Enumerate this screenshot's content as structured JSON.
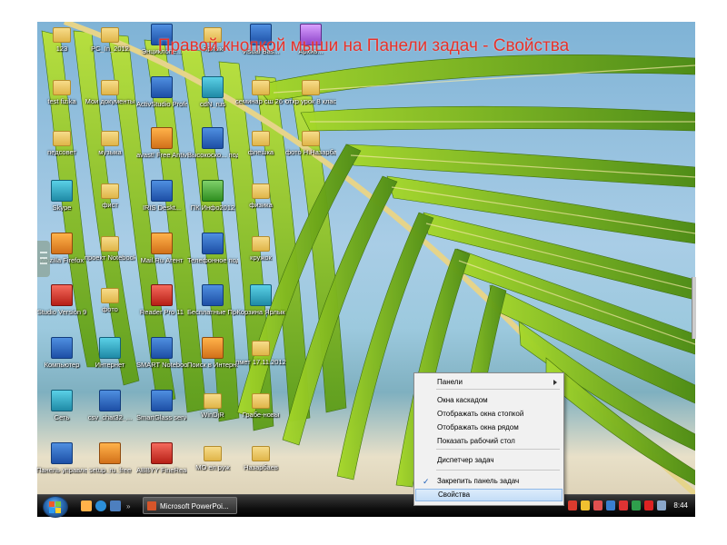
{
  "slide_title": "Правой кнопкой мыши на Панели задач - Свойства",
  "desktop_icons": [
    {
      "label": "123",
      "kind": "folder"
    },
    {
      "label": "PC_In_2012",
      "kind": "folder"
    },
    {
      "label": "Энциклопе...",
      "kind": "app",
      "color": "app"
    },
    {
      "label": "Ярлык",
      "kind": "folder"
    },
    {
      "label": "Visual Bas...",
      "kind": "app",
      "color": "app"
    },
    {
      "label": "Архив...",
      "kind": "app",
      "color": "purple"
    },
    {
      "label": "test fizika",
      "kind": "folder"
    },
    {
      "label": "Мои документы",
      "kind": "folder"
    },
    {
      "label": "ActivStudio Professio...",
      "kind": "app",
      "color": "app"
    },
    {
      "label": "cdN_rus",
      "kind": "app",
      "color": "teal"
    },
    {
      "label": "семинар сш 26 О ИВТ 20...",
      "kind": "folder"
    },
    {
      "label": "откр урок 8 класс 201...",
      "kind": "folder"
    },
    {
      "label": "педсовет",
      "kind": "folder"
    },
    {
      "label": "музыка",
      "kind": "folder"
    },
    {
      "label": "avast! Free Antivirus",
      "kind": "app",
      "color": "orange"
    },
    {
      "label": "Высокоско... подключе...",
      "kind": "app",
      "color": "app"
    },
    {
      "label": "флешка",
      "kind": "folder"
    },
    {
      "label": "фото Н.Назарба...",
      "kind": "folder"
    },
    {
      "label": "Skype",
      "kind": "app",
      "color": "teal"
    },
    {
      "label": "фист",
      "kind": "folder"
    },
    {
      "label": "IRIS Deskt...",
      "kind": "app",
      "color": "app"
    },
    {
      "label": "ПК Инфо2012",
      "kind": "app",
      "color": "green"
    },
    {
      "label": "физика",
      "kind": "folder"
    },
    {
      "label": "Mozilla Firefox",
      "kind": "app",
      "color": "orange"
    },
    {
      "label": "проект Notebook",
      "kind": "folder"
    },
    {
      "label": "Mail.Ru Агент",
      "kind": "app",
      "color": "orange"
    },
    {
      "label": "Телефонное подключе...",
      "kind": "app",
      "color": "app"
    },
    {
      "label": "кружок",
      "kind": "folder"
    },
    {
      "label": "Studio Version 9",
      "kind": "app",
      "color": "red"
    },
    {
      "label": "фото",
      "kind": "folder"
    },
    {
      "label": "Reader Pro 11",
      "kind": "app",
      "color": "red"
    },
    {
      "label": "Бесплатные Программ...",
      "kind": "app",
      "color": "app"
    },
    {
      "label": "Корзина Ярлык",
      "kind": "app",
      "color": "teal"
    },
    {
      "label": "Компьютер",
      "kind": "app",
      "color": "app"
    },
    {
      "label": "Интернет",
      "kind": "app",
      "color": "teal"
    },
    {
      "label": "SMART Notebook 10",
      "kind": "app",
      "color": "app"
    },
    {
      "label": "Поиск в Интернете",
      "kind": "app",
      "color": "orange"
    },
    {
      "label": "пмет 17.11.2012",
      "kind": "folder"
    },
    {
      "label": "Сеть",
      "kind": "app",
      "color": "teal"
    },
    {
      "label": "csv_chat32_...",
      "kind": "app",
      "color": "app"
    },
    {
      "label": "SmartGlass server",
      "kind": "app",
      "color": "app"
    },
    {
      "label": "WinDjR",
      "kind": "folder"
    },
    {
      "label": "Грабе-новы",
      "kind": "folder"
    },
    {
      "label": "Панель управления",
      "kind": "app",
      "color": "app"
    },
    {
      "label": "setup_ru_free",
      "kind": "app",
      "color": "orange"
    },
    {
      "label": "ABBYY FineReade...",
      "kind": "app",
      "color": "red"
    },
    {
      "label": "МО ел руж",
      "kind": "folder"
    },
    {
      "label": "Назарбаев",
      "kind": "folder"
    }
  ],
  "taskbar": {
    "window_button": "Microsoft PowerPoi...",
    "clock": "8:44"
  },
  "context_menu": {
    "items": [
      {
        "label": "Панели",
        "submenu": true
      },
      {
        "label": "Окна каскадом"
      },
      {
        "label": "Отображать окна стопкой"
      },
      {
        "label": "Отображать окна рядом"
      },
      {
        "label": "Показать рабочий стол"
      },
      {
        "label": "Диспетчер задач"
      },
      {
        "label": "Закрепить панель задач",
        "checked": true
      },
      {
        "label": "Свойства",
        "highlighted": true
      }
    ]
  },
  "colors": {
    "title": "#e8322a",
    "menu_highlight": "#c4ddf7",
    "taskbar": "#101010"
  }
}
